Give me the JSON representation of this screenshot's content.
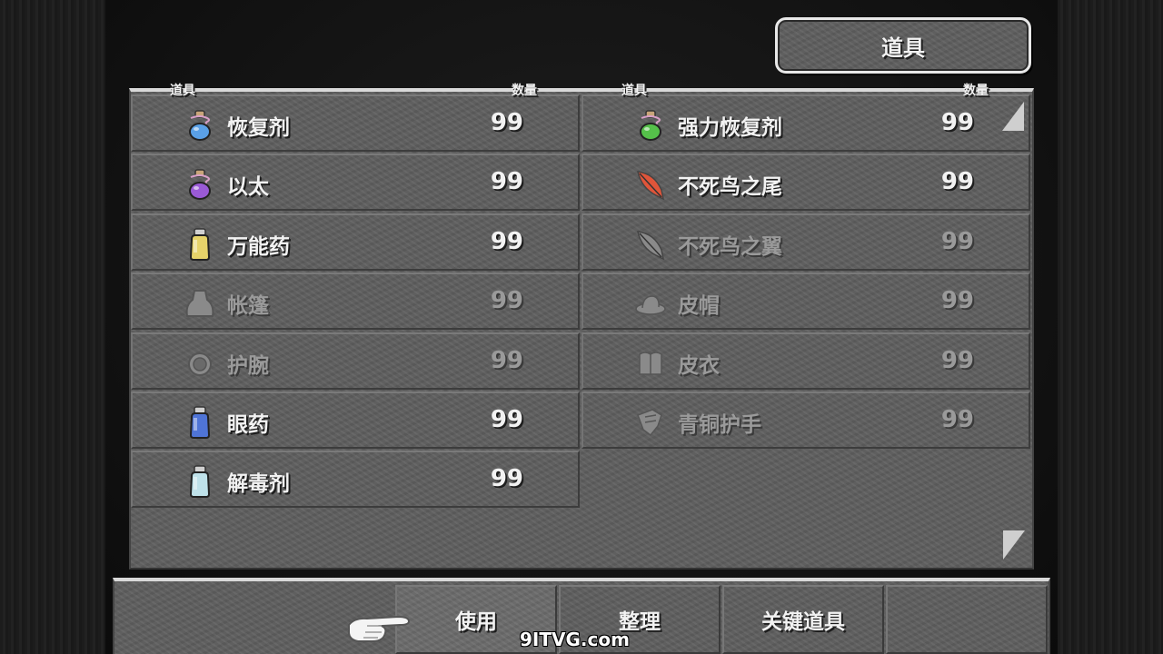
{
  "menu_title": "道具",
  "columns": {
    "left": {
      "item_header": "道具",
      "qty_header": "数量"
    },
    "right": {
      "item_header": "道具",
      "qty_header": "数量"
    }
  },
  "left_items": [
    {
      "name": "恢复剂",
      "qty": "99",
      "icon": "blue-potion-icon",
      "color": "#5aa0e6",
      "usable": true
    },
    {
      "name": "以太",
      "qty": "99",
      "icon": "purple-potion-icon",
      "color": "#9a5ad6",
      "usable": true
    },
    {
      "name": "万能药",
      "qty": "99",
      "icon": "yellow-bottle-icon",
      "color": "#e6d36a",
      "usable": true
    },
    {
      "name": "帐篷",
      "qty": "99",
      "icon": "tent-icon",
      "color": "#8a8a8a",
      "usable": false
    },
    {
      "name": "护腕",
      "qty": "99",
      "icon": "armlet-icon",
      "color": "#8a8a8a",
      "usable": false
    },
    {
      "name": "眼药",
      "qty": "99",
      "icon": "blue-bottle-icon",
      "color": "#4f74d6",
      "usable": true
    },
    {
      "name": "解毒剂",
      "qty": "99",
      "icon": "light-blue-bottle-icon",
      "color": "#bfe2ea",
      "usable": true
    }
  ],
  "right_items": [
    {
      "name": "强力恢复剂",
      "qty": "99",
      "icon": "green-potion-icon",
      "color": "#55c04a",
      "usable": true
    },
    {
      "name": "不死鸟之尾",
      "qty": "99",
      "icon": "phoenix-feather-icon",
      "color": "#e0553a",
      "usable": true
    },
    {
      "name": "不死鸟之翼",
      "qty": "99",
      "icon": "grey-feather-icon",
      "color": "#8a8a8a",
      "usable": false
    },
    {
      "name": "皮帽",
      "qty": "99",
      "icon": "hat-icon",
      "color": "#8a8a8a",
      "usable": false
    },
    {
      "name": "皮衣",
      "qty": "99",
      "icon": "armor-icon",
      "color": "#8a8a8a",
      "usable": false
    },
    {
      "name": "青铜护手",
      "qty": "99",
      "icon": "gauntlet-icon",
      "color": "#8a8a8a",
      "usable": false
    }
  ],
  "commands": [
    {
      "label": "使用",
      "selected": true
    },
    {
      "label": "整理",
      "selected": false
    },
    {
      "label": "关键道具",
      "selected": false
    }
  ],
  "watermark": "9ITVG.com"
}
